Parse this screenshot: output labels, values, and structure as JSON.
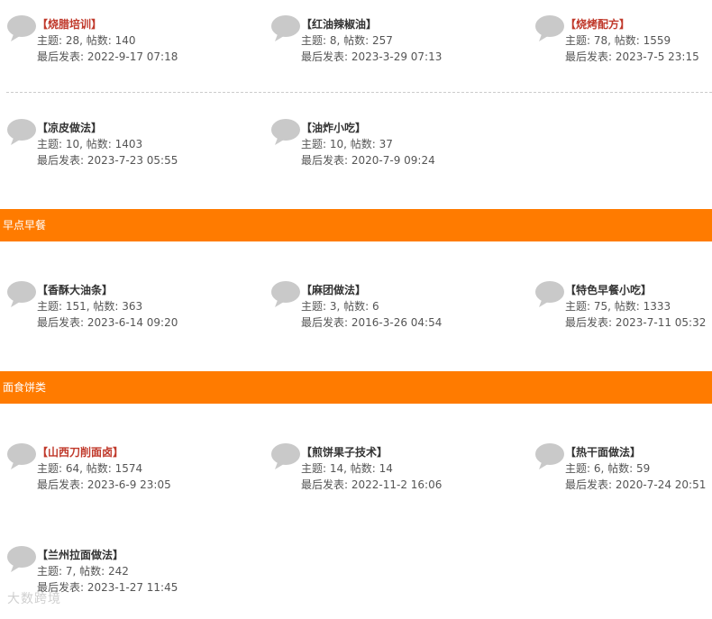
{
  "labels": {
    "topics_prefix": "主题: ",
    "posts_prefix": ", 帖数: ",
    "last_post_prefix": "最后发表: "
  },
  "groups": [
    {
      "name": "",
      "rows": [
        [
          {
            "title": "【烧腊培训】",
            "hot": true,
            "topics": "28",
            "posts": "140",
            "last": "2022-9-17 07:18"
          },
          {
            "title": "【红油辣椒油】",
            "hot": false,
            "topics": "8",
            "posts": "257",
            "last": "2023-3-29 07:13"
          },
          {
            "title": "【烧烤配方】",
            "hot": true,
            "topics": "78",
            "posts": "1559",
            "last": "2023-7-5 23:15"
          }
        ],
        [
          {
            "title": "【凉皮做法】",
            "hot": false,
            "topics": "10",
            "posts": "1403",
            "last": "2023-7-23 05:55"
          },
          {
            "title": "【油炸小吃】",
            "hot": false,
            "topics": "10",
            "posts": "37",
            "last": "2020-7-9 09:24"
          }
        ]
      ]
    },
    {
      "name": "早点早餐",
      "rows": [
        [
          {
            "title": "【香酥大油条】",
            "hot": false,
            "topics": "151",
            "posts": "363",
            "last": "2023-6-14 09:20"
          },
          {
            "title": "【麻团做法】",
            "hot": false,
            "topics": "3",
            "posts": "6",
            "last": "2016-3-26 04:54"
          },
          {
            "title": "【特色早餐小吃】",
            "hot": false,
            "topics": "75",
            "posts": "1333",
            "last": "2023-7-11 05:32"
          }
        ]
      ]
    },
    {
      "name": "面食饼类",
      "rows": [
        [
          {
            "title": "【山西刀削面卤】",
            "hot": true,
            "topics": "64",
            "posts": "1574",
            "last": "2023-6-9 23:05"
          },
          {
            "title": "【煎饼果子技术】",
            "hot": false,
            "topics": "14",
            "posts": "14",
            "last": "2022-11-2 16:06"
          },
          {
            "title": "【热干面做法】",
            "hot": false,
            "topics": "6",
            "posts": "59",
            "last": "2020-7-24 20:51"
          }
        ],
        [
          {
            "title": "【兰州拉面做法】",
            "hot": false,
            "topics": "7",
            "posts": "242",
            "last": "2023-1-27 11:45"
          }
        ]
      ]
    }
  ],
  "watermark": "大数跨境",
  "colors": {
    "band": "#ff7b00",
    "hot_title": "#c0392b"
  }
}
